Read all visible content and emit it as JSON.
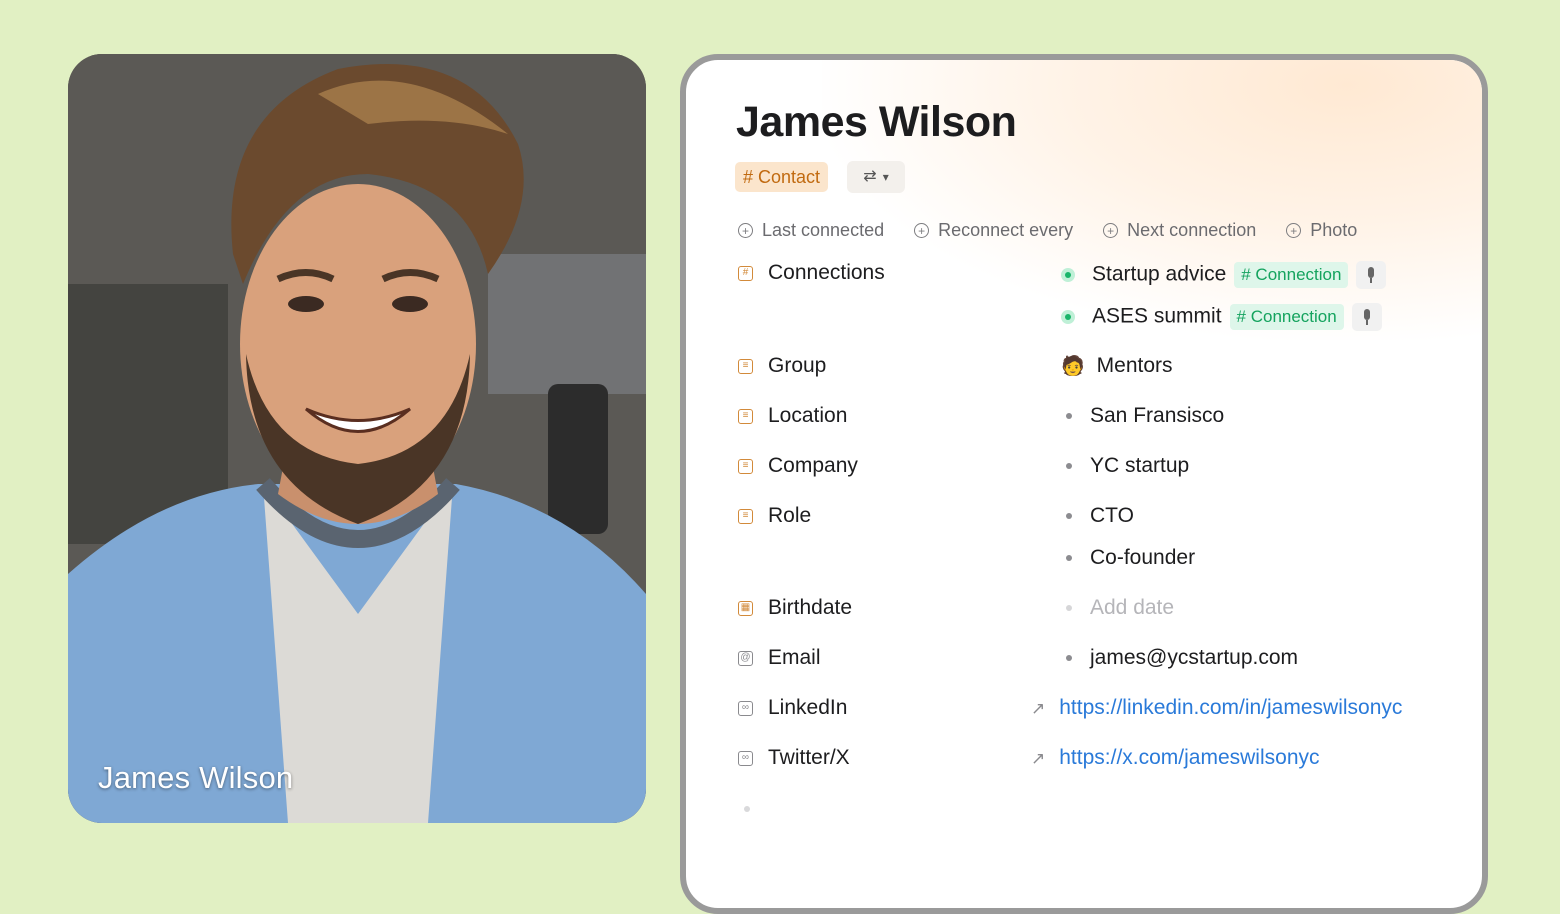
{
  "photo": {
    "caption": "James Wilson"
  },
  "profile": {
    "name": "James Wilson",
    "type_tag": "# Contact",
    "switch_icon": "swap-arrows-icon",
    "property_actions": [
      {
        "label": "Last connected"
      },
      {
        "label": "Reconnect every"
      },
      {
        "label": "Next connection"
      },
      {
        "label": "Photo"
      }
    ],
    "connections": {
      "label": "Connections",
      "items": [
        {
          "title": "Startup advice",
          "tag": "# Connection"
        },
        {
          "title": "ASES summit",
          "tag": "# Connection"
        }
      ]
    },
    "group": {
      "label": "Group",
      "value": "Mentors",
      "icon": "mentor-emoji-icon"
    },
    "location": {
      "label": "Location",
      "value": "San Fransisco"
    },
    "company": {
      "label": "Company",
      "value": "YC startup"
    },
    "role": {
      "label": "Role",
      "values": [
        "CTO",
        "Co-founder"
      ]
    },
    "birthdate": {
      "label": "Birthdate",
      "placeholder": "Add date"
    },
    "email": {
      "label": "Email",
      "value": "james@ycstartup.com"
    },
    "linkedin": {
      "label": "LinkedIn",
      "url": "https://linkedin.com/in/jameswilsonyc"
    },
    "twitter": {
      "label": "Twitter/X",
      "url": "https://x.com/jameswilsonyc"
    }
  },
  "colors": {
    "background": "#e1f0c3",
    "contact_tag": "#c16a10",
    "connection_tag": "#14a35e",
    "link": "#2a7ad9"
  }
}
